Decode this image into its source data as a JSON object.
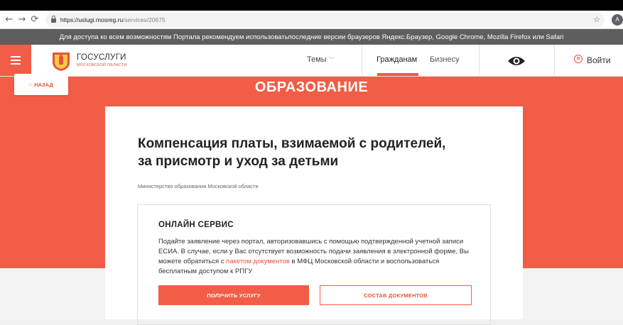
{
  "browser": {
    "url_host": "https://uslugi.mosreg.ru",
    "url_path": "/services/20675",
    "profile_initial": "A"
  },
  "notice": {
    "text": "Для доступа ко всем возможностям Портала рекомендуем использоватьпоследние версии браузеров Яндекс.Браузер, Google Chrome, Mozilla Firefox или Safari"
  },
  "header": {
    "brand_name": "ГОСУСЛУГИ",
    "brand_region": "МОСКОВСКОЙ ОБЛАСТИ",
    "nav": {
      "themes": "Темы",
      "citizens": "Гражданам",
      "business": "Бизнесу"
    },
    "login": "Войти"
  },
  "page": {
    "back_label": "НАЗАД",
    "section_title": "ОБРАЗОВАНИЕ",
    "service_title_line1": "Компенсация платы, взимаемой с родителей,",
    "service_title_line2": "за присмотр и уход за детьми",
    "ministry": "Министерство образования Московской области"
  },
  "online_service": {
    "title": "ОНЛАЙН СЕРВИС",
    "text_before_link": "Подайте заявление через портал, авторизовавшись с помощью подтвержденной учетной записи ЕСИА. В случае, если у Вас отсутствует возможность подачи заявления в электронной форме, Вы можете обратиться с ",
    "link_text": "пакетом документов",
    "text_after_link": " в МФЦ Московской области и воспользоваться бесплатным доступом к РПГУ",
    "get_service_button": "ПОЛУЧИТЬ УСЛУГУ",
    "documents_button": "СОСТАВ ДОКУМЕНТОВ"
  },
  "colors": {
    "accent": "#f15d46",
    "notice_bg": "#5e5e5e"
  }
}
